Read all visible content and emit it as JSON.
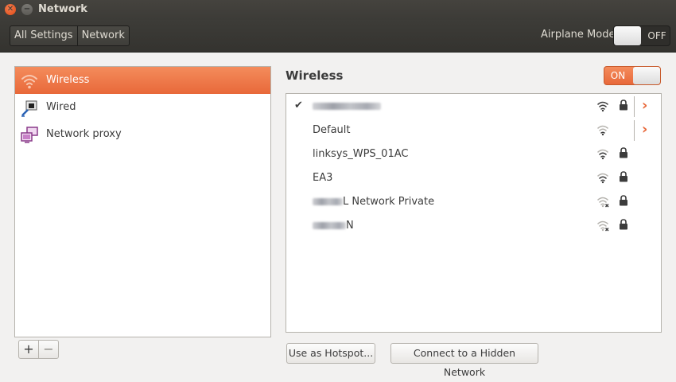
{
  "window": {
    "title": "Network"
  },
  "header": {
    "breadcrumbs": [
      "All Settings",
      "Network"
    ],
    "airplane_mode_label": "Airplane Mode",
    "airplane_mode_state": "OFF"
  },
  "devices": [
    {
      "label": "Wireless",
      "icon": "wifi-icon",
      "selected": true
    },
    {
      "label": "Wired",
      "icon": "wired-network-icon",
      "selected": false
    },
    {
      "label": "Network proxy",
      "icon": "network-proxy-icon",
      "selected": false
    }
  ],
  "list_tools": {
    "add_label": "+",
    "remove_label": "−"
  },
  "wireless": {
    "title": "Wireless",
    "toggle_state": "ON",
    "check_mark": "✔",
    "networks": [
      {
        "ssid": "",
        "connected": true,
        "signal": "wifi-signal-icon",
        "secured": true,
        "has_details": true
      },
      {
        "ssid": "Default",
        "connected": false,
        "signal": "wifi-signal-icon",
        "secured": false,
        "has_details": true
      },
      {
        "ssid": "linksys_WPS_01AC",
        "connected": false,
        "signal": "wifi-signal-icon",
        "secured": true,
        "has_details": false
      },
      {
        "ssid": "EA3",
        "connected": false,
        "signal": "wifi-signal-icon",
        "secured": true,
        "has_details": false
      },
      {
        "ssid": "L Network Private",
        "connected": false,
        "signal": "wifi-signal-weak-icon",
        "secured": true,
        "has_details": false
      },
      {
        "ssid": "N",
        "connected": false,
        "signal": "wifi-signal-weak-icon",
        "secured": true,
        "has_details": false
      }
    ],
    "hotspot_button": "Use as Hotspot...",
    "hidden_network_button": "Connect to a Hidden Network"
  },
  "colors": {
    "accent": "#e8683a",
    "titlebar": "#3c3b37",
    "window_bg": "#f2f1f0"
  }
}
